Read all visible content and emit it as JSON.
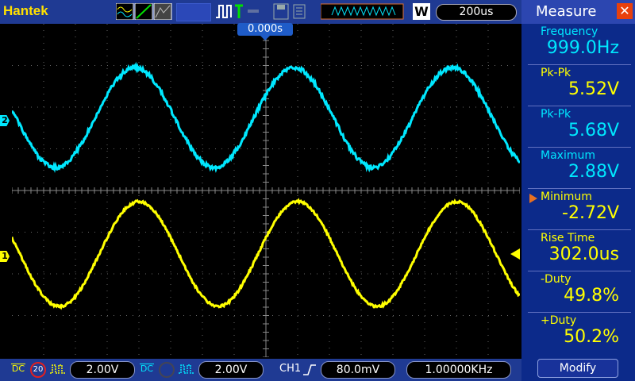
{
  "topbar": {
    "brand": "Hantek",
    "timebase": "200us",
    "trigger_time": "0.000s",
    "memory_label": "W"
  },
  "channels": {
    "ch1": {
      "marker": "1",
      "color": "#ffff00",
      "coupling": "DC",
      "scale": "2.00V",
      "bw_limit": "20"
    },
    "ch2": {
      "marker": "2",
      "color": "#00e8ff",
      "coupling": "DC",
      "scale": "2.00V"
    }
  },
  "trigger": {
    "source": "CH1",
    "level": "80.0mV",
    "frequency": "1.00000KHz"
  },
  "measure": {
    "title": "Measure",
    "items": [
      {
        "label": "Frequency",
        "value": "999.0Hz",
        "color": "#00e8ff"
      },
      {
        "label": "Pk-Pk",
        "value": "5.52V",
        "color": "#ffff00"
      },
      {
        "label": "Pk-Pk",
        "value": "5.68V",
        "color": "#00e8ff"
      },
      {
        "label": "Maximum",
        "value": "2.88V",
        "color": "#00e8ff"
      },
      {
        "label": "Minimum",
        "value": "-2.72V",
        "color": "#ffff00"
      },
      {
        "label": "Rise Time",
        "value": "302.0us",
        "color": "#ffff00"
      },
      {
        "label": "-Duty",
        "value": "49.8%",
        "color": "#ffff00"
      },
      {
        "label": "+Duty",
        "value": "50.2%",
        "color": "#ffff00"
      }
    ],
    "modify_label": "Modify"
  }
}
